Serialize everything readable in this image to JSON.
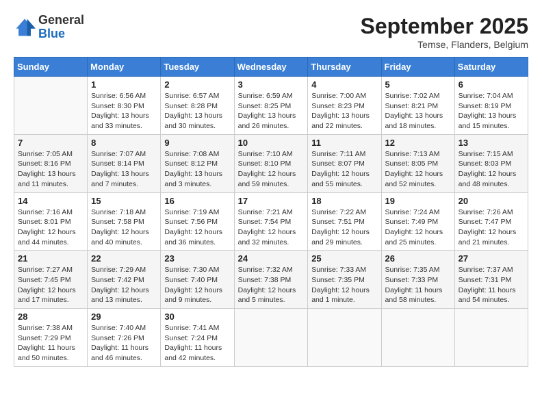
{
  "header": {
    "logo_general": "General",
    "logo_blue": "Blue",
    "month_title": "September 2025",
    "location": "Temse, Flanders, Belgium"
  },
  "days_of_week": [
    "Sunday",
    "Monday",
    "Tuesday",
    "Wednesday",
    "Thursday",
    "Friday",
    "Saturday"
  ],
  "weeks": [
    [
      {
        "day": "",
        "info": ""
      },
      {
        "day": "1",
        "info": "Sunrise: 6:56 AM\nSunset: 8:30 PM\nDaylight: 13 hours\nand 33 minutes."
      },
      {
        "day": "2",
        "info": "Sunrise: 6:57 AM\nSunset: 8:28 PM\nDaylight: 13 hours\nand 30 minutes."
      },
      {
        "day": "3",
        "info": "Sunrise: 6:59 AM\nSunset: 8:25 PM\nDaylight: 13 hours\nand 26 minutes."
      },
      {
        "day": "4",
        "info": "Sunrise: 7:00 AM\nSunset: 8:23 PM\nDaylight: 13 hours\nand 22 minutes."
      },
      {
        "day": "5",
        "info": "Sunrise: 7:02 AM\nSunset: 8:21 PM\nDaylight: 13 hours\nand 18 minutes."
      },
      {
        "day": "6",
        "info": "Sunrise: 7:04 AM\nSunset: 8:19 PM\nDaylight: 13 hours\nand 15 minutes."
      }
    ],
    [
      {
        "day": "7",
        "info": "Sunrise: 7:05 AM\nSunset: 8:16 PM\nDaylight: 13 hours\nand 11 minutes."
      },
      {
        "day": "8",
        "info": "Sunrise: 7:07 AM\nSunset: 8:14 PM\nDaylight: 13 hours\nand 7 minutes."
      },
      {
        "day": "9",
        "info": "Sunrise: 7:08 AM\nSunset: 8:12 PM\nDaylight: 13 hours\nand 3 minutes."
      },
      {
        "day": "10",
        "info": "Sunrise: 7:10 AM\nSunset: 8:10 PM\nDaylight: 12 hours\nand 59 minutes."
      },
      {
        "day": "11",
        "info": "Sunrise: 7:11 AM\nSunset: 8:07 PM\nDaylight: 12 hours\nand 55 minutes."
      },
      {
        "day": "12",
        "info": "Sunrise: 7:13 AM\nSunset: 8:05 PM\nDaylight: 12 hours\nand 52 minutes."
      },
      {
        "day": "13",
        "info": "Sunrise: 7:15 AM\nSunset: 8:03 PM\nDaylight: 12 hours\nand 48 minutes."
      }
    ],
    [
      {
        "day": "14",
        "info": "Sunrise: 7:16 AM\nSunset: 8:01 PM\nDaylight: 12 hours\nand 44 minutes."
      },
      {
        "day": "15",
        "info": "Sunrise: 7:18 AM\nSunset: 7:58 PM\nDaylight: 12 hours\nand 40 minutes."
      },
      {
        "day": "16",
        "info": "Sunrise: 7:19 AM\nSunset: 7:56 PM\nDaylight: 12 hours\nand 36 minutes."
      },
      {
        "day": "17",
        "info": "Sunrise: 7:21 AM\nSunset: 7:54 PM\nDaylight: 12 hours\nand 32 minutes."
      },
      {
        "day": "18",
        "info": "Sunrise: 7:22 AM\nSunset: 7:51 PM\nDaylight: 12 hours\nand 29 minutes."
      },
      {
        "day": "19",
        "info": "Sunrise: 7:24 AM\nSunset: 7:49 PM\nDaylight: 12 hours\nand 25 minutes."
      },
      {
        "day": "20",
        "info": "Sunrise: 7:26 AM\nSunset: 7:47 PM\nDaylight: 12 hours\nand 21 minutes."
      }
    ],
    [
      {
        "day": "21",
        "info": "Sunrise: 7:27 AM\nSunset: 7:45 PM\nDaylight: 12 hours\nand 17 minutes."
      },
      {
        "day": "22",
        "info": "Sunrise: 7:29 AM\nSunset: 7:42 PM\nDaylight: 12 hours\nand 13 minutes."
      },
      {
        "day": "23",
        "info": "Sunrise: 7:30 AM\nSunset: 7:40 PM\nDaylight: 12 hours\nand 9 minutes."
      },
      {
        "day": "24",
        "info": "Sunrise: 7:32 AM\nSunset: 7:38 PM\nDaylight: 12 hours\nand 5 minutes."
      },
      {
        "day": "25",
        "info": "Sunrise: 7:33 AM\nSunset: 7:35 PM\nDaylight: 12 hours\nand 1 minute."
      },
      {
        "day": "26",
        "info": "Sunrise: 7:35 AM\nSunset: 7:33 PM\nDaylight: 11 hours\nand 58 minutes."
      },
      {
        "day": "27",
        "info": "Sunrise: 7:37 AM\nSunset: 7:31 PM\nDaylight: 11 hours\nand 54 minutes."
      }
    ],
    [
      {
        "day": "28",
        "info": "Sunrise: 7:38 AM\nSunset: 7:29 PM\nDaylight: 11 hours\nand 50 minutes."
      },
      {
        "day": "29",
        "info": "Sunrise: 7:40 AM\nSunset: 7:26 PM\nDaylight: 11 hours\nand 46 minutes."
      },
      {
        "day": "30",
        "info": "Sunrise: 7:41 AM\nSunset: 7:24 PM\nDaylight: 11 hours\nand 42 minutes."
      },
      {
        "day": "",
        "info": ""
      },
      {
        "day": "",
        "info": ""
      },
      {
        "day": "",
        "info": ""
      },
      {
        "day": "",
        "info": ""
      }
    ]
  ]
}
